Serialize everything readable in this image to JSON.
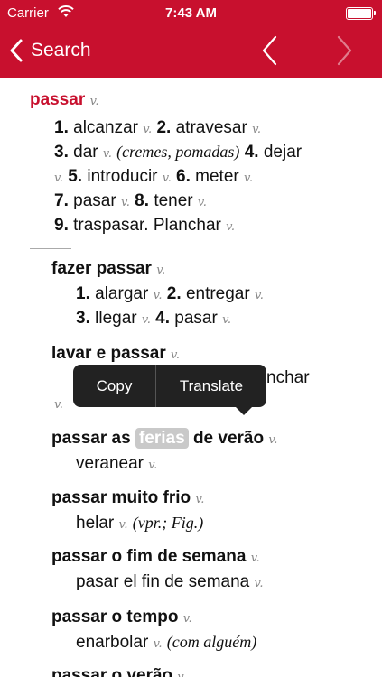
{
  "status": {
    "carrier": "Carrier",
    "time": "7:43 AM"
  },
  "nav": {
    "back_label": "Search"
  },
  "colors": {
    "brand": "#c8102e"
  },
  "entry": {
    "headword": "passar",
    "pos": "v.",
    "translations": {
      "l1_n1": "1.",
      "l1_w1": "alcanzar",
      "l1_p1": "v.",
      "l1_n2": "2.",
      "l1_w2": "atravesar",
      "l1_p2": "v.",
      "l2_n1": "3.",
      "l2_w1": "dar",
      "l2_p1": "v.",
      "l2_note": "(cremes, pomadas)",
      "l2_n2": "4.",
      "l2_w2": "dejar",
      "l3_p0": "v.",
      "l3_n1": "5.",
      "l3_w1": "introducir",
      "l3_p1": "v.",
      "l3_n2": "6.",
      "l3_w2": "meter",
      "l3_p2": "v.",
      "l4_n1": "7.",
      "l4_w1": "pasar",
      "l4_p1": "v.",
      "l4_n2": "8.",
      "l4_w2": "tener",
      "l4_p2": "v.",
      "l5_n1": "9.",
      "l5_w1": "traspasar. Planchar",
      "l5_p1": "v."
    }
  },
  "phrases": {
    "fazer_passar": {
      "title": "fazer passar",
      "pos": "v.",
      "n1": "1.",
      "w1": "alargar",
      "p1": "v.",
      "n2": "2.",
      "w2": "entregar",
      "p2": "v.",
      "n3": "3.",
      "w3": "llegar",
      "p3": "v.",
      "n4": "4.",
      "w4": "pasar",
      "p4": "v."
    },
    "lavar_e_passar": {
      "title": "lavar e passar",
      "pos": "v.",
      "partial": "nchar",
      "partial_pos": "v."
    },
    "passar_as_ferias": {
      "title_a": "passar as",
      "title_highlight": "ferias",
      "title_b": "de verão",
      "pos": "v.",
      "translation": "veranear",
      "tpos": "v."
    },
    "passar_muito_frio": {
      "title": "passar muito frio",
      "pos": "v.",
      "translation": "helar",
      "tpos": "v.",
      "note": "(vpr.; Fig.)"
    },
    "passar_o_fim_de_semana": {
      "title": "passar o fim de semana",
      "pos": "v.",
      "translation": "pasar el fin de semana",
      "tpos": "v."
    },
    "passar_o_tempo": {
      "title": "passar o tempo",
      "pos": "v.",
      "translation": "enarbolar",
      "tpos": "v.",
      "note": "(com alguém)"
    },
    "passar_o_verao": {
      "title": "passar o verão",
      "pos": "v."
    }
  },
  "popup": {
    "copy": "Copy",
    "translate": "Translate"
  }
}
